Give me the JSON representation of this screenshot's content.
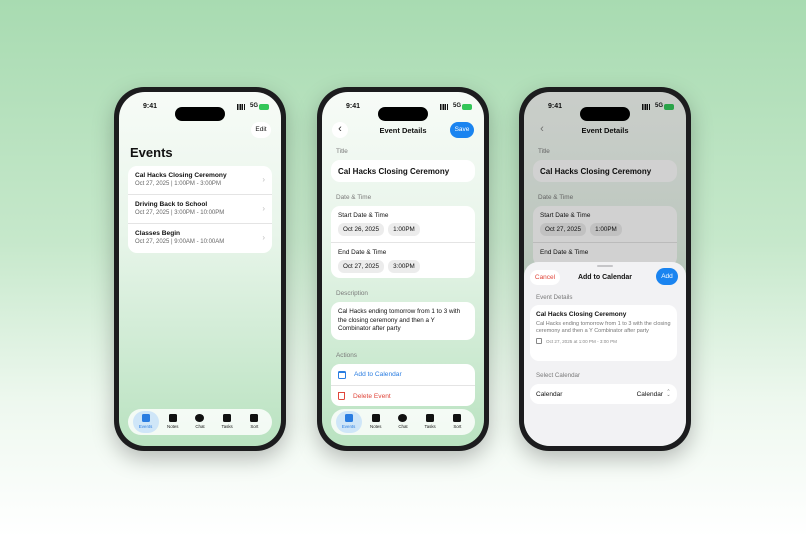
{
  "status": {
    "time": "9:41",
    "network": "5G"
  },
  "tabs": [
    {
      "label": "Events",
      "icon": "calendar-icon"
    },
    {
      "label": "Notes",
      "icon": "document-icon"
    },
    {
      "label": "Chat",
      "icon": "chat-bubble-icon"
    },
    {
      "label": "Tasks",
      "icon": "clipboard-icon"
    },
    {
      "label": "Sort",
      "icon": "tray-icon"
    }
  ],
  "events_screen": {
    "edit_label": "Edit",
    "title": "Events",
    "events": [
      {
        "name": "Cal Hacks Closing Ceremony",
        "detail": "Oct 27, 2025 | 1:00PM - 3:00PM"
      },
      {
        "name": "Driving Back to School",
        "detail": "Oct 27, 2025 | 3:00PM - 10:00PM"
      },
      {
        "name": "Classes Begin",
        "detail": "Oct 27, 2025 | 9:00AM - 10:00AM"
      }
    ]
  },
  "details_screen": {
    "nav_title": "Event Details",
    "save_label": "Save",
    "title_label": "Title",
    "title_value": "Cal Hacks Closing Ceremony",
    "datetime_label": "Date & Time",
    "start_label": "Start Date & Time",
    "start_date": "Oct 26, 2025",
    "start_time": "1:00PM",
    "end_label": "End Date & Time",
    "end_date": "Oct 27, 2025",
    "end_time": "3:00PM",
    "description_label": "Description",
    "description": "Cal Hacks ending tomorrow from 1 to 3 with the closing ceremony and then a Y Combinator after party",
    "actions_label": "Actions",
    "add_to_calendar": "Add to Calendar",
    "delete_event": "Delete Event"
  },
  "sheet_screen": {
    "nav_title": "Event Details",
    "title_label": "Title",
    "title_value": "Cal Hacks Closing Ceremony",
    "datetime_label": "Date & Time",
    "start_label": "Start Date & Time",
    "start_date": "Oct 27, 2025",
    "start_time": "1:00PM",
    "end_label": "End Date & Time",
    "sheet": {
      "cancel_label": "Cancel",
      "title": "Add to Calendar",
      "add_label": "Add",
      "event_details_label": "Event Details",
      "event_name": "Cal Hacks Closing Ceremony",
      "event_desc": "Cal Hacks ending tomorrow from 1 to 3 with the closing ceremony and then a Y Combinator after party",
      "event_when": "Oct 27, 2025 at 1:00 PM - 3:00 PM",
      "select_calendar_label": "Select Calendar",
      "calendar_label": "Calendar",
      "calendar_value": "Calendar"
    }
  },
  "colors": {
    "accent": "#1a84f0",
    "danger": "#e0453a",
    "battery": "#34c759"
  }
}
